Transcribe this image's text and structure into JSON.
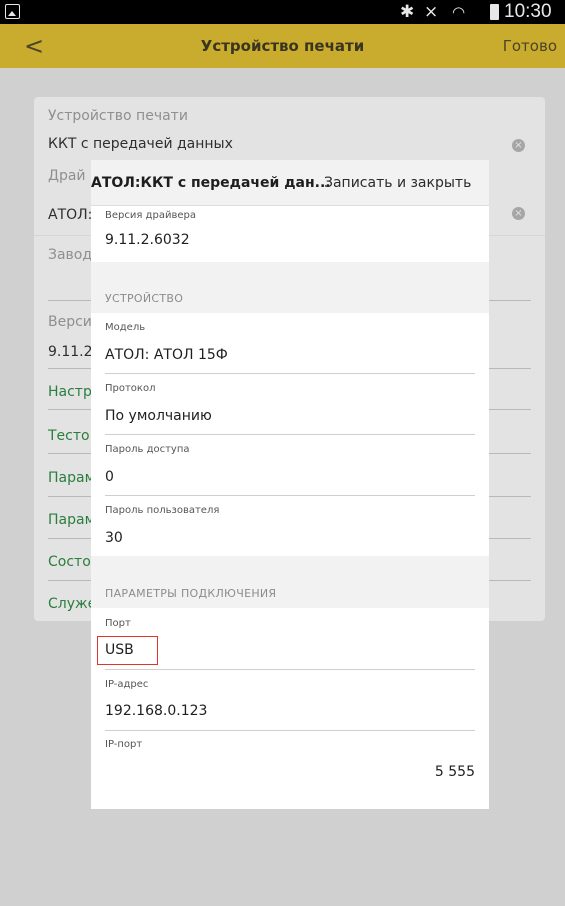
{
  "status_bar": {
    "time": "10:30",
    "icons": [
      "screenshot-icon",
      "bluetooth-icon",
      "mute-icon",
      "wifi-icon",
      "battery-icon"
    ]
  },
  "header": {
    "back_symbol": "<",
    "title": "Устройство печати",
    "done_label": "Готово"
  },
  "background_form": {
    "device_label": "Устройство печати",
    "device_value": "ККТ с передачей данных",
    "driver_label_partial": "Драй",
    "driver_value_partial": "АТОЛ:",
    "serial_label_partial": "Завод",
    "version_label_partial": "Верси",
    "version_value_partial": "9.11.2",
    "links_partial": [
      "Настр",
      "Тесто",
      "Парам",
      "Парам",
      "Состо",
      "Служе"
    ]
  },
  "dialog": {
    "title": "АТОЛ:ККТ с передачей дан...",
    "save_close_label": "Записать и закрыть",
    "driver_version_label": "Версия драйвера",
    "driver_version_value": "9.11.2.6032",
    "device_section": "УСТРОЙСТВО",
    "model_label": "Модель",
    "model_value": "АТОЛ: АТОЛ 15Ф",
    "protocol_label": "Протокол",
    "protocol_value": "По умолчанию",
    "access_password_label": "Пароль доступа",
    "access_password_value": "0",
    "user_password_label": "Пароль пользователя",
    "user_password_value": "30",
    "connection_section": "ПАРАМЕТРЫ ПОДКЛЮЧЕНИЯ",
    "port_label": "Порт",
    "port_value": "USB",
    "ip_address_label": "IP-адрес",
    "ip_address_value": "192.168.0.123",
    "ip_port_label": "IP-порт",
    "ip_port_value": "5 555"
  },
  "colors": {
    "header_bg": "#c9ab2d",
    "link_green": "#2a7e3c",
    "highlight_red": "#e0352b"
  }
}
